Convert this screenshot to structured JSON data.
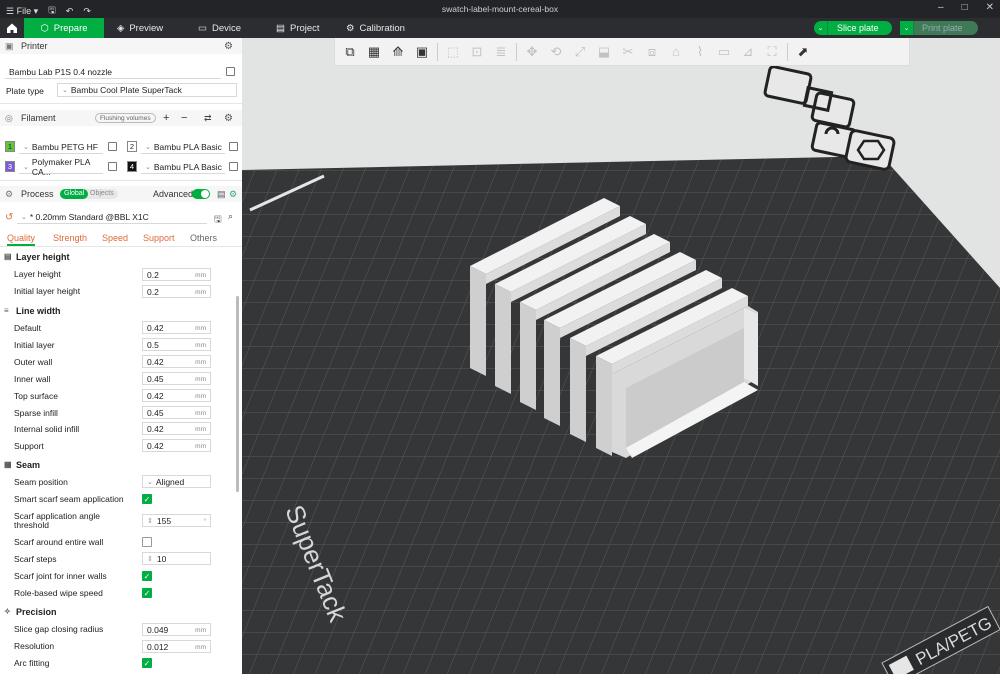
{
  "titlebar": {
    "menu_label": "File",
    "title": "swatch-label-mount-cereal-box"
  },
  "tabs": [
    {
      "label": "Prepare",
      "icon": "cube-icon"
    },
    {
      "label": "Preview",
      "icon": "layers-icon"
    },
    {
      "label": "Device",
      "icon": "monitor-icon"
    },
    {
      "label": "Project",
      "icon": "document-icon"
    },
    {
      "label": "Calibration",
      "icon": "gear-icon"
    }
  ],
  "actions": {
    "slice": "Slice plate",
    "print": "Print plate"
  },
  "printer": {
    "header": "Printer",
    "name": "Bambu Lab P1S 0.4 nozzle",
    "plate_type_label": "Plate type",
    "plate_type": "Bambu Cool Plate SuperTack"
  },
  "filament": {
    "header": "Filament",
    "flushing": "Flushing volumes",
    "items": [
      {
        "num": "1",
        "name": "Bambu PETG HF",
        "color": "#5ec63a"
      },
      {
        "num": "2",
        "name": "Bambu PLA Basic",
        "color": "#ffffff"
      },
      {
        "num": "3",
        "name": "Polymaker PLA CA...",
        "color": "#7b5bd6"
      },
      {
        "num": "4",
        "name": "Bambu PLA Basic",
        "color": "#111111"
      }
    ]
  },
  "process": {
    "header": "Process",
    "global": "Global",
    "objects": "Objects",
    "advanced": "Advanced",
    "preset": "* 0.20mm Standard @BBL X1C",
    "tabs": [
      "Quality",
      "Strength",
      "Speed",
      "Support",
      "Others"
    ]
  },
  "groups": {
    "layer_height": {
      "title": "Layer height",
      "rows": [
        {
          "label": "Layer height",
          "value": "0.2",
          "unit": "mm"
        },
        {
          "label": "Initial layer height",
          "value": "0.2",
          "unit": "mm"
        }
      ]
    },
    "line_width": {
      "title": "Line width",
      "rows": [
        {
          "label": "Default",
          "value": "0.42",
          "unit": "mm"
        },
        {
          "label": "Initial layer",
          "value": "0.5",
          "unit": "mm"
        },
        {
          "label": "Outer wall",
          "value": "0.42",
          "unit": "mm"
        },
        {
          "label": "Inner wall",
          "value": "0.45",
          "unit": "mm"
        },
        {
          "label": "Top surface",
          "value": "0.42",
          "unit": "mm"
        },
        {
          "label": "Sparse infill",
          "value": "0.45",
          "unit": "mm"
        },
        {
          "label": "Internal solid infill",
          "value": "0.42",
          "unit": "mm"
        },
        {
          "label": "Support",
          "value": "0.42",
          "unit": "mm"
        }
      ]
    },
    "seam": {
      "title": "Seam",
      "seam_position_label": "Seam position",
      "seam_position": "Aligned",
      "smart_scarf_label": "Smart scarf seam application",
      "scarf_angle_label_1": "Scarf application angle",
      "scarf_angle_label_2": "threshold",
      "scarf_angle": "155",
      "scarf_angle_unit": "°",
      "scarf_entire_label": "Scarf around entire wall",
      "scarf_steps_label": "Scarf steps",
      "scarf_steps": "10",
      "scarf_inner_label": "Scarf joint for inner walls",
      "role_wipe_label": "Role-based wipe speed"
    },
    "precision": {
      "title": "Precision",
      "slice_gap_label": "Slice gap closing radius",
      "slice_gap": "0.049",
      "resolution_label": "Resolution",
      "resolution": "0.012",
      "unit": "mm",
      "arc_label": "Arc fitting"
    }
  },
  "viewport": {
    "plate_brand": "SuperTack",
    "plate_material": "PLA/PETG"
  }
}
